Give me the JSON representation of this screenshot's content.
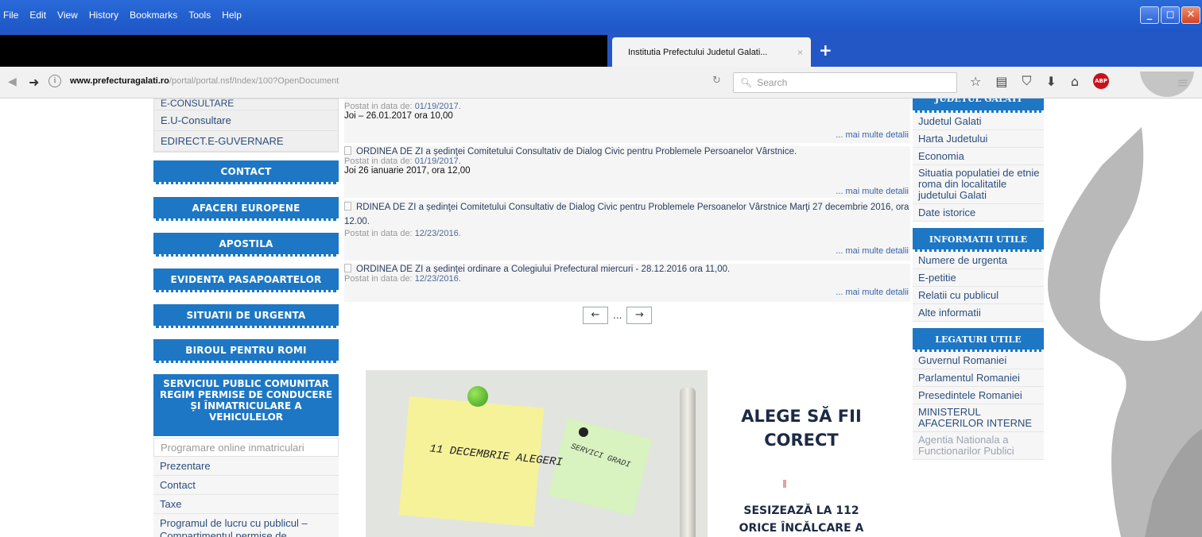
{
  "menubar": [
    "File",
    "Edit",
    "View",
    "History",
    "Bookmarks",
    "Tools",
    "Help"
  ],
  "window_buttons": {
    "minimize": "_",
    "maximize": "◻",
    "close": "✕"
  },
  "tab": {
    "title": "Institutia Prefectului Judetul Galati...",
    "close": "×",
    "new_tab": "+"
  },
  "address": {
    "host": "www.prefecturagalati.ro",
    "path": "/portal/portal.nsf/Index/100?OpenDocument",
    "prefix": "www."
  },
  "search": {
    "placeholder": "Search"
  },
  "left_menu": {
    "items": [
      "E-CONSULTARE",
      "E.U-Consultare",
      "EDIRECT.E-GUVERNARE"
    ],
    "buttons": [
      "CONTACT",
      "AFACERI EUROPENE",
      "APOSTILA",
      "EVIDENTA PASAPOARTELOR",
      "SITUATII DE URGENTA",
      "BIROUL PENTRU ROMI"
    ],
    "big_button": "SERVICIUL PUBLIC COMUNITAR REGIM PERMISE DE CONDUCERE ȘI ÎNMATRICULARE A VEHICULELOR",
    "sub_items": [
      "Programare online inmatriculari",
      "Prezentare",
      "Contact",
      "Taxe",
      "Programul de lucru cu publicul – Compartimentul permise de"
    ]
  },
  "news": {
    "posted_label": "Postat in data de:",
    "more": "... mai multe detalii",
    "items": [
      {
        "title": "",
        "date": "01/19/2017.",
        "text": "Joi – 26.01.2017 ora 10,00"
      },
      {
        "title": "ORDINEA DE ZI a ședinţei Comitetului Consultativ de Dialog Civic pentru Problemele Persoanelor Vârstnice.",
        "date": "01/19/2017.",
        "text": "Joi 26 ianuarie 2017, ora 12,00"
      },
      {
        "title": "RDINEA DE ZI a ședinţei Comitetului Consultativ de Dialog Civic pentru Problemele Persoanelor Vârstnice Marţi 27 decembrie 2016, ora 12.00.",
        "date": "12/23/2016.",
        "text": ""
      },
      {
        "title": "ORDINEA DE ZI a ședinţei ordinare a Colegiului Prefectural miercuri - 28.12.2016 ora 11,00.",
        "date": "12/23/2016.",
        "text": ""
      }
    ]
  },
  "pager": {
    "prev": "←",
    "dots": "...",
    "next": "→"
  },
  "banner": {
    "note1": "11 DECEMBRIE ALEGERI",
    "note2": "SERVICI GRADI",
    "slogan1": "ALEGE SĂ FII CORECT",
    "slogan2": "SESIZEAZĂ LA 112 ORICE ÎNCĂLCARE A"
  },
  "right_menu": {
    "top_header": "JUDETUL GALATI",
    "judet_links": [
      "Judetul Galati",
      "Harta Judetului",
      "Economia",
      "Situatia populatiei de etnie roma din localitatile judetului Galati",
      "Date istorice"
    ],
    "info_header": "INFORMATII UTILE",
    "info_links": [
      "Numere de urgenta",
      "E-petitie",
      "Relatii cu publicul",
      "Alte informatii"
    ],
    "links_header": "LEGATURI UTILE",
    "legaturi_links": [
      "Guvernul Romaniei",
      "Parlamentul Romaniei",
      "Presedintele Romaniei",
      "MINISTERUL AFACERILOR INTERNE",
      "Agentia Nationala a Functionarilor Publici"
    ]
  }
}
